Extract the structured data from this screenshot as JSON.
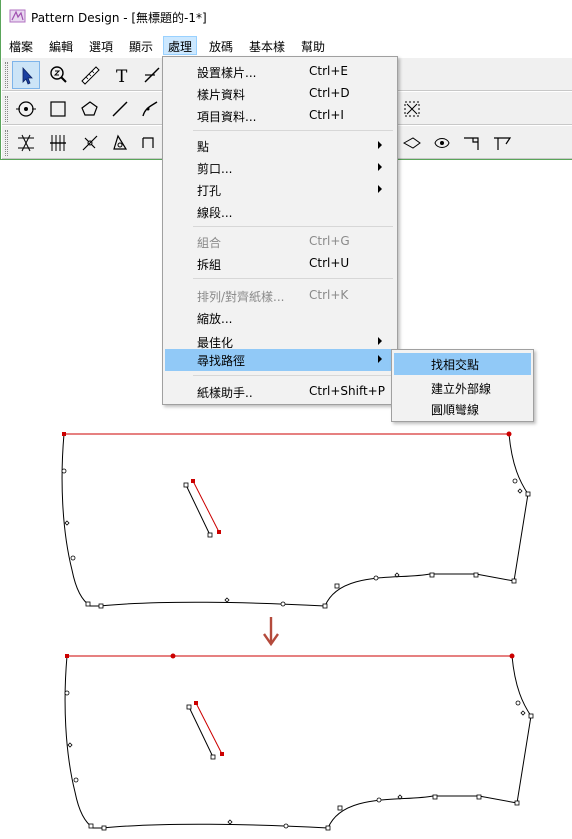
{
  "window": {
    "title": "Pattern Design - [無標題的-1*]"
  },
  "menubar": {
    "items": [
      "檔案",
      "編輯",
      "選項",
      "顯示",
      "處理",
      "放碼",
      "基本樣",
      "幫助"
    ],
    "active_index": 4
  },
  "toolbar": {
    "row1_icons": [
      "select-arrow-icon",
      "zoom-icon",
      "ruler-icon",
      "text-icon",
      "cut-line-icon"
    ],
    "row2_icons": [
      "circle-target-icon",
      "rectangle-icon",
      "polygon-icon",
      "line-icon",
      "curve-icon",
      "fit-frame-icon"
    ],
    "row3_icons": [
      "pleat-icon",
      "measure-icon",
      "split-icon",
      "shape-icon",
      "shape2-icon",
      "arc-icon",
      "notch-icon",
      "corner-icon",
      "flag-icon"
    ]
  },
  "dropdown": {
    "items": [
      {
        "label": "設置樣片...",
        "shortcut": "Ctrl+E"
      },
      {
        "label": "樣片資料",
        "shortcut": "Ctrl+D"
      },
      {
        "label": "項目資料...",
        "shortcut": "Ctrl+I"
      },
      {
        "label": "點"
      },
      {
        "label": "剪口..."
      },
      {
        "label": "打孔"
      },
      {
        "label": "線段..."
      },
      {
        "label": "組合",
        "shortcut": "Ctrl+G"
      },
      {
        "label": "拆組",
        "shortcut": "Ctrl+U"
      },
      {
        "label": "排列/對齊紙樣...",
        "shortcut": "Ctrl+K"
      },
      {
        "label": "縮放..."
      },
      {
        "label": "最佳化"
      },
      {
        "label": "尋找路徑"
      },
      {
        "label": "紙樣助手..",
        "shortcut": "Ctrl+Shift+P"
      }
    ]
  },
  "submenu": {
    "items": [
      "找相交點",
      "建立外部線",
      "圓順彎線"
    ]
  },
  "colors": {
    "accent_red": "#cc0000",
    "menu_highlight": "#91c9f7",
    "arrow_red": "#b44a3c"
  }
}
